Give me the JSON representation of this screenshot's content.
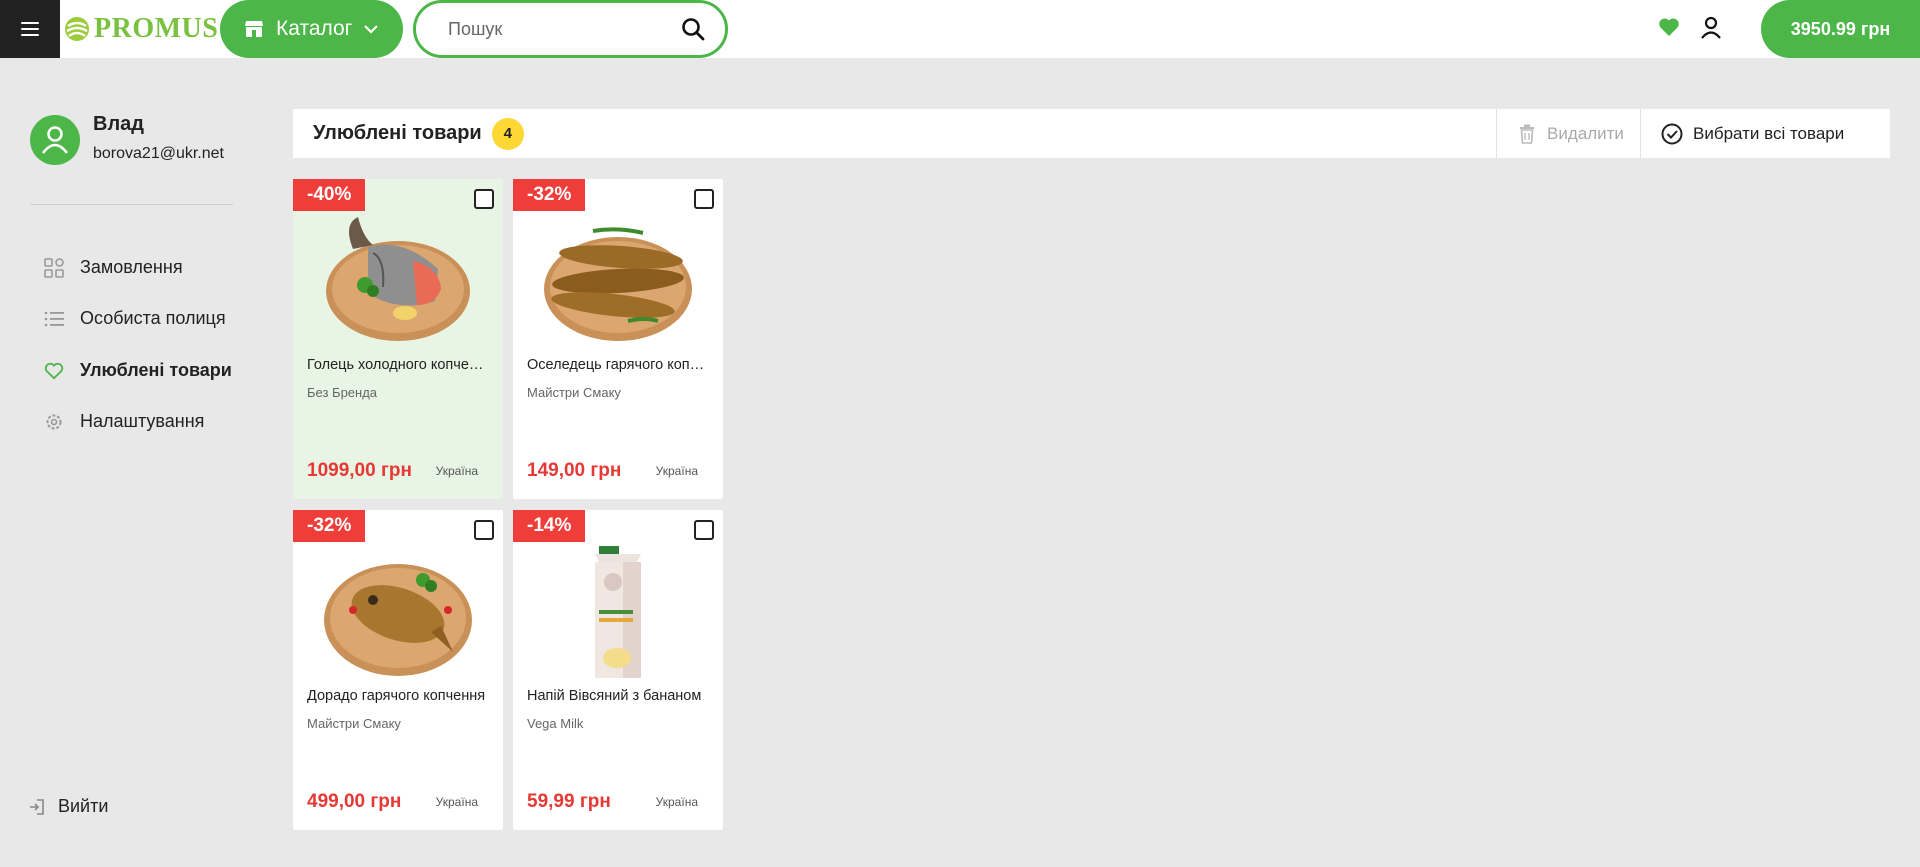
{
  "header": {
    "logo_text": "PROMUS",
    "catalog_label": "Каталог",
    "search_placeholder": "Пошук",
    "cart_total": "3950.99 грн",
    "brand_color": "#4cb648"
  },
  "user": {
    "name": "Влад",
    "email": "borova21@ukr.net"
  },
  "sidebar": {
    "items": [
      {
        "label": "Замовлення",
        "icon": "grid-icon"
      },
      {
        "label": "Особиста полиця",
        "icon": "list-icon"
      },
      {
        "label": "Улюблені товари",
        "icon": "heart-icon",
        "active": true
      },
      {
        "label": "Налаштування",
        "icon": "gear-icon"
      }
    ],
    "logout_label": "Вийти"
  },
  "toolbar": {
    "title": "Улюблені товари",
    "count": "4",
    "delete_label": "Видалити",
    "select_all_label": "Вибрати всі товари"
  },
  "products": [
    {
      "discount": "-40%",
      "name": "Голець холодного копчення",
      "brand": "Без Бренда",
      "price": "1099,00 грн",
      "country": "Україна",
      "image": "smoked-char-fish-image"
    },
    {
      "discount": "-32%",
      "name": "Оселедець гарячого копчення",
      "brand": "Майстри Смаку",
      "price": "149,00 грн",
      "country": "Україна",
      "image": "smoked-herring-image"
    },
    {
      "discount": "-32%",
      "name": "Дорадо гарячого копчення",
      "brand": "Майстри Смаку",
      "price": "499,00 грн",
      "country": "Україна",
      "image": "smoked-dorado-image"
    },
    {
      "discount": "-14%",
      "name": "Напій Вівсяний з бананом",
      "brand": "Vega Milk",
      "price": "59,99 грн",
      "country": "Україна",
      "image": "oat-drink-carton-image"
    }
  ]
}
